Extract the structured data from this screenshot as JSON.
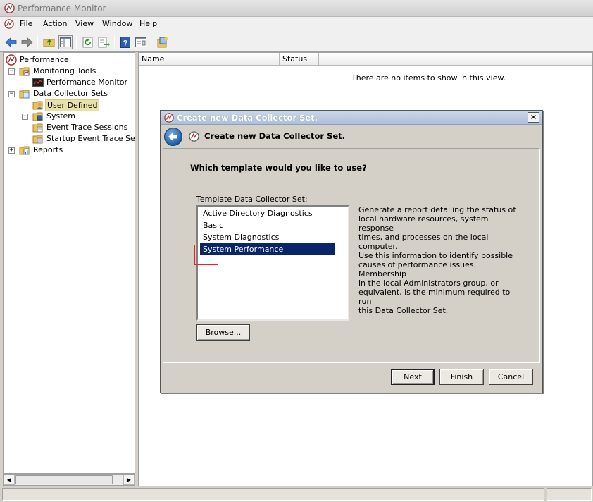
{
  "window": {
    "title": "Performance Monitor",
    "app_icon": "perfmon-icon"
  },
  "menu": {
    "items": [
      {
        "label": "File"
      },
      {
        "label": "Action"
      },
      {
        "label": "View"
      },
      {
        "label": "Window"
      },
      {
        "label": "Help"
      }
    ]
  },
  "toolbar": {
    "buttons": [
      "back-arrow-icon",
      "forward-arrow-icon",
      "up-folder-icon",
      "show-hide-tree-icon",
      "refresh-icon",
      "export-list-icon",
      "help-icon",
      "properties-icon",
      "new-icon"
    ]
  },
  "tree": {
    "items": [
      {
        "label": "Performance",
        "icon": "perfmon-icon"
      },
      {
        "label": "Monitoring Tools",
        "icon": "folder-tools-icon",
        "expander": "−"
      },
      {
        "label": "Performance Monitor",
        "icon": "chart-icon"
      },
      {
        "label": "Data Collector Sets",
        "icon": "folder-data-icon",
        "expander": "−"
      },
      {
        "label": "User Defined",
        "icon": "user-folder-icon",
        "selected": true
      },
      {
        "label": "System",
        "icon": "system-folder-icon",
        "expander": "+"
      },
      {
        "label": "Event Trace Sessions",
        "icon": "trace-folder-icon"
      },
      {
        "label": "Startup Event Trace Sess",
        "icon": "trace-folder-icon"
      },
      {
        "label": "Reports",
        "icon": "reports-folder-icon",
        "expander": "+"
      }
    ]
  },
  "list": {
    "columns": [
      "Name",
      "Status"
    ],
    "empty_message": "There are no items to show in this view."
  },
  "dialog": {
    "title": "Create new Data Collector Set.",
    "header": "Create new Data Collector Set.",
    "question": "Which template would you like to use?",
    "template_label": "Template Data Collector Set:",
    "templates": [
      {
        "label": "Active Directory Diagnostics"
      },
      {
        "label": "Basic"
      },
      {
        "label": "System Diagnostics"
      },
      {
        "label": "System Performance",
        "selected": true
      }
    ],
    "description_lines": [
      "Generate a report detailing the status of",
      "local hardware resources, system response",
      "times, and processes on the local computer.",
      "Use this information to identify possible",
      "causes of performance issues. Membership",
      "in the local Administrators group, or",
      "equivalent, is the minimum required to run",
      "this Data Collector Set."
    ],
    "browse_label": "Browse...",
    "next_label": "Next",
    "finish_label": "Finish",
    "cancel_label": "Cancel",
    "close_glyph": "✕"
  },
  "colors": {
    "selection": "#0a246a",
    "dialog_title_bg": "#aebfd7",
    "tree_selected_bg": "#e8e2a8",
    "annotation_red": "#e22222"
  }
}
